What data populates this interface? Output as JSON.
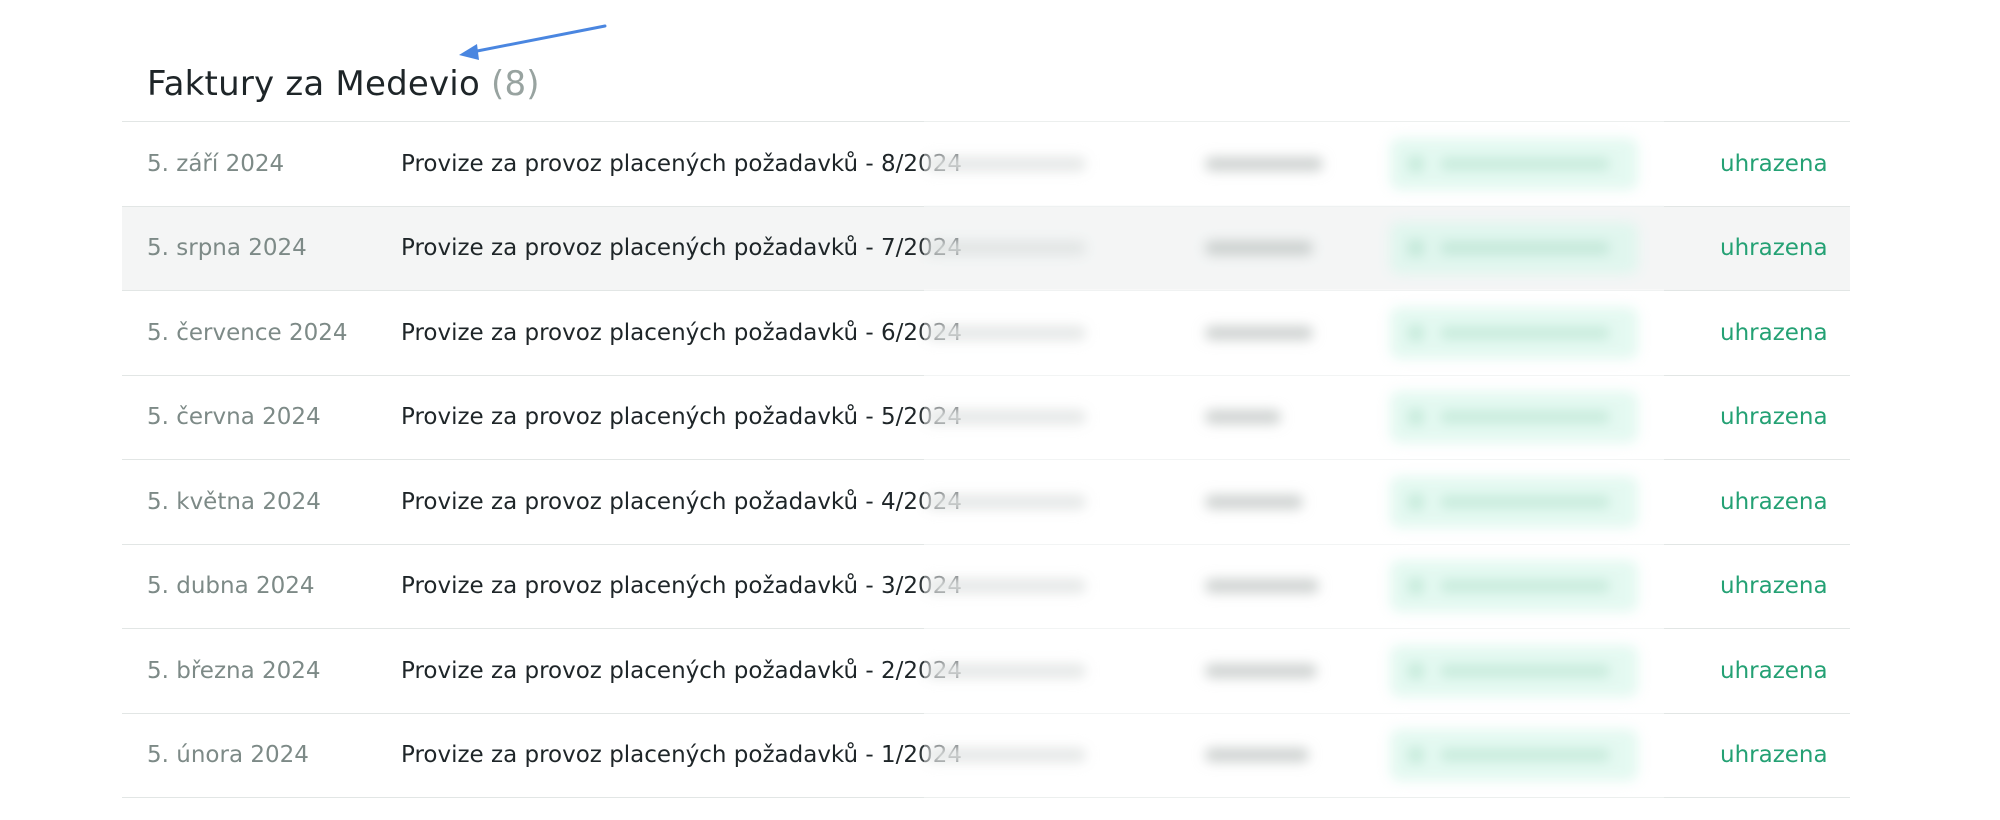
{
  "page": {
    "title": "Faktury za Medevio",
    "count": "(8)"
  },
  "invoices": [
    {
      "date": "5. září 2024",
      "description": "Provize za provoz placených požadavků - 8/2024",
      "status": "uhrazena",
      "amount_blur_width": 118
    },
    {
      "date": "5. srpna 2024",
      "description": "Provize za provoz placených požadavků - 7/2024",
      "status": "uhrazena",
      "amount_blur_width": 108
    },
    {
      "date": "5. července 2024",
      "description": "Provize za provoz placených požadavků - 6/2024",
      "status": "uhrazena",
      "amount_blur_width": 108
    },
    {
      "date": "5. června 2024",
      "description": "Provize za provoz placených požadavků - 5/2024",
      "status": "uhrazena",
      "amount_blur_width": 76
    },
    {
      "date": "5. května 2024",
      "description": "Provize za provoz placených požadavků - 4/2024",
      "status": "uhrazena",
      "amount_blur_width": 98
    },
    {
      "date": "5. dubna 2024",
      "description": "Provize za provoz placených požadavků - 3/2024",
      "status": "uhrazena",
      "amount_blur_width": 114
    },
    {
      "date": "5. března 2024",
      "description": "Provize za provoz placených požadavků - 2/2024",
      "status": "uhrazena",
      "amount_blur_width": 112
    },
    {
      "date": "5. února 2024",
      "description": "Provize za provoz placených požadavků - 1/2024",
      "status": "uhrazena",
      "amount_blur_width": 104
    }
  ],
  "highlighted_row": 1,
  "colors": {
    "status_paid": "#24a174",
    "annotation_arrow": "#4a86e0",
    "highlight_row": "#f4f5f5"
  },
  "icons": {
    "annotation": "arrow-annotation-icon",
    "invoice": "document-icon"
  }
}
